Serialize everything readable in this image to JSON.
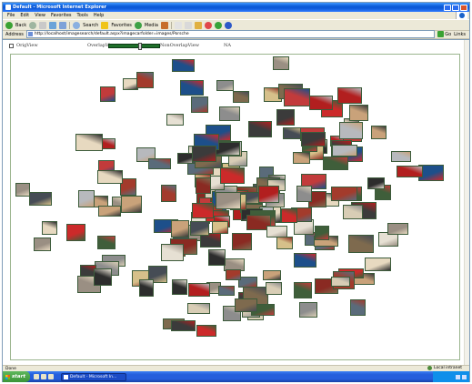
{
  "window": {
    "title": "Default - Microsoft Internet Explorer"
  },
  "menu": {
    "items": [
      "File",
      "Edit",
      "View",
      "Favorites",
      "Tools",
      "Help"
    ]
  },
  "toolbar": {
    "back_label": "Back",
    "search_label": "Search",
    "favorites_label": "Favorites",
    "media_label": "Media"
  },
  "address": {
    "label": "Address",
    "url": "http://localhost/imagesearch/default.aspx?imagecarfolder=images/Porsche",
    "go_label": "Go",
    "links_label": "Links"
  },
  "controls": {
    "orig_view_label": "OrigView",
    "overlap_view_label": "OverlapView",
    "non_overlap_view_label": "NonOverlapView",
    "na_label": "NA",
    "overlap_level": 0.62,
    "orig_view_checked": false
  },
  "status": {
    "left": "Done",
    "zone": "Local intranet"
  },
  "taskbar": {
    "start_label": "start",
    "task_label": "Default - Microsoft In..."
  },
  "thumbnails": [
    {
      "name": "thumb-01",
      "color": "#c9a27a"
    },
    {
      "name": "thumb-02",
      "color": "#8a2a22"
    },
    {
      "name": "thumb-03",
      "color": "#d8cdb5"
    },
    {
      "name": "thumb-04",
      "color": "#3b3b3b"
    },
    {
      "name": "thumb-05",
      "color": "#b21f1f"
    },
    {
      "name": "thumb-06",
      "color": "#9a8f83"
    },
    {
      "name": "thumb-07",
      "color": "#e6e0d3"
    },
    {
      "name": "thumb-08",
      "color": "#5a6b7a"
    },
    {
      "name": "thumb-09",
      "color": "#cc2a2a"
    },
    {
      "name": "thumb-10",
      "color": "#2d2d2d"
    },
    {
      "name": "thumb-11",
      "color": "#7e6a4e"
    },
    {
      "name": "thumb-12",
      "color": "#b7b9bd"
    },
    {
      "name": "thumb-13",
      "color": "#a33b2c"
    },
    {
      "name": "thumb-14",
      "color": "#464c55"
    },
    {
      "name": "thumb-15",
      "color": "#d6c08a"
    },
    {
      "name": "thumb-16",
      "color": "#1d4f8a"
    },
    {
      "name": "thumb-17",
      "color": "#c23b3b"
    },
    {
      "name": "thumb-18",
      "color": "#8d8d8d"
    },
    {
      "name": "thumb-19",
      "color": "#e7d9c0"
    },
    {
      "name": "thumb-20",
      "color": "#3f5e3a"
    }
  ]
}
